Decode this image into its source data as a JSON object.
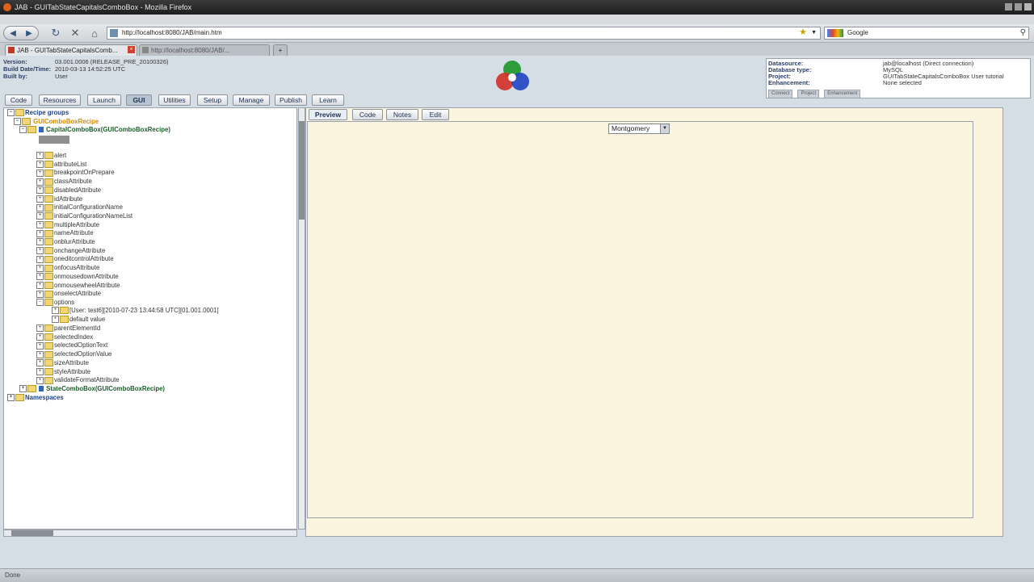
{
  "window": {
    "title": "JAB - GUITabStateCapitalsComboBox - Mozilla Firefox"
  },
  "browser": {
    "url": "http://localhost:8080/JAB/main.htm",
    "search_engine": "Google",
    "tabs": [
      {
        "label": "JAB - GUITabStateCapitalsComb..."
      },
      {
        "label": "http://localhost:8080/JAB/..."
      }
    ]
  },
  "meta_left": [
    {
      "key": "Version:",
      "value": "03.001.0006 (RELEASE_PRE_20100326)"
    },
    {
      "key": "Build Date/Time:",
      "value": "2010-03-13 14:52:25 UTC"
    },
    {
      "key": "Built by:",
      "value": "User"
    }
  ],
  "info_box": {
    "rows": [
      {
        "key": "Datasource:",
        "value": "jab@localhost (Direct connection)"
      },
      {
        "key": "Database type:",
        "value": "MySQL"
      },
      {
        "key": "Project:",
        "value": "GUITabStateCapitalsComboBox User tutorial"
      },
      {
        "key": "Enhancement:",
        "value": "None selected"
      }
    ],
    "buttons": [
      "Connect",
      "Project",
      "Enhancement"
    ]
  },
  "main_tabs": [
    "Code",
    "Resources",
    "Launch",
    "GUI",
    "Utilities",
    "Setup",
    "Manage",
    "Publish",
    "Learn"
  ],
  "active_main_tab": "GUI",
  "tree": {
    "root": "Recipe groups",
    "group": "GUIComboBoxRecipe",
    "recipe1": "CapitalComboBox(GUIComboBoxRecipe)",
    "attributes": [
      "alert",
      "attributeList",
      "breakpointOnPrepare",
      "classAttribute",
      "disabledAttribute",
      "idAttribute",
      "initialConfigurationName",
      "initialConfigurationNameList",
      "multipleAttribute",
      "nameAttribute",
      "onblurAttribute",
      "onchangeAttribute",
      "oneditcontrolAttribute",
      "onfocusAttribute",
      "onmousedownAttribute",
      "onmousewheelAttribute",
      "onselectAttribute",
      "options"
    ],
    "option_child1": "[User: test6][2010-07-23 13:44:58 UTC][01.001.0001]",
    "option_child2": "default value",
    "attributes2": [
      "parentElementId",
      "selectedIndex",
      "selectedOptionText",
      "selectedOptionValue",
      "sizeAttribute",
      "styleAttribute",
      "validateFormatAttribute"
    ],
    "recipe2": "StateComboBox(GUIComboBoxRecipe)",
    "namespaces": "Namespaces"
  },
  "right_tabs": [
    "Preview",
    "Code",
    "Notes",
    "Edit"
  ],
  "active_right_tab": "Preview",
  "combo": {
    "selected": "Montgomery"
  },
  "status": "Done",
  "colors": {
    "preview_bg": "#fbf5df",
    "recipe_text": "#1a5c2a",
    "group_text": "#d08a00"
  }
}
